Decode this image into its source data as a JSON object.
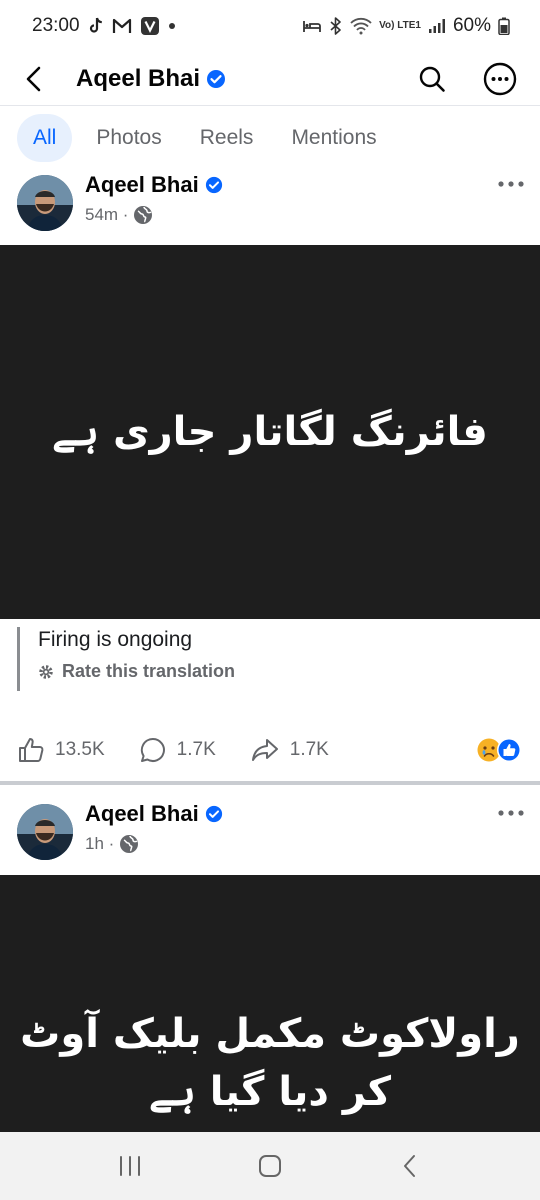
{
  "status_bar": {
    "time": "23:00",
    "battery": "60%",
    "net_label": "Vo) LTE1"
  },
  "header": {
    "title": "Aqeel Bhai",
    "back_icon": "chevron-left-icon",
    "search_icon": "search-icon",
    "more_icon": "more-circle-icon"
  },
  "tabs": [
    {
      "label": "All"
    },
    {
      "label": "Photos"
    },
    {
      "label": "Reels"
    },
    {
      "label": "Mentions"
    }
  ],
  "colors": {
    "accent": "#0866ff",
    "post_bg": "#1e1e1e",
    "verified": "#0866ff"
  },
  "posts": [
    {
      "author": "Aqeel Bhai",
      "time": "54m ·",
      "image_text": [
        "فائرنگ لگاتار جاری ہے"
      ],
      "translation": "Firing is ongoing",
      "rate_label": "Rate this translation",
      "likes": "13.5K",
      "comments": "1.7K",
      "shares": "1.7K"
    },
    {
      "author": "Aqeel Bhai",
      "time": "1h ·",
      "image_text": [
        "راولاکوٹ مکمل بلیک آوٹ",
        "کر دیا گیا ہے"
      ]
    }
  ]
}
